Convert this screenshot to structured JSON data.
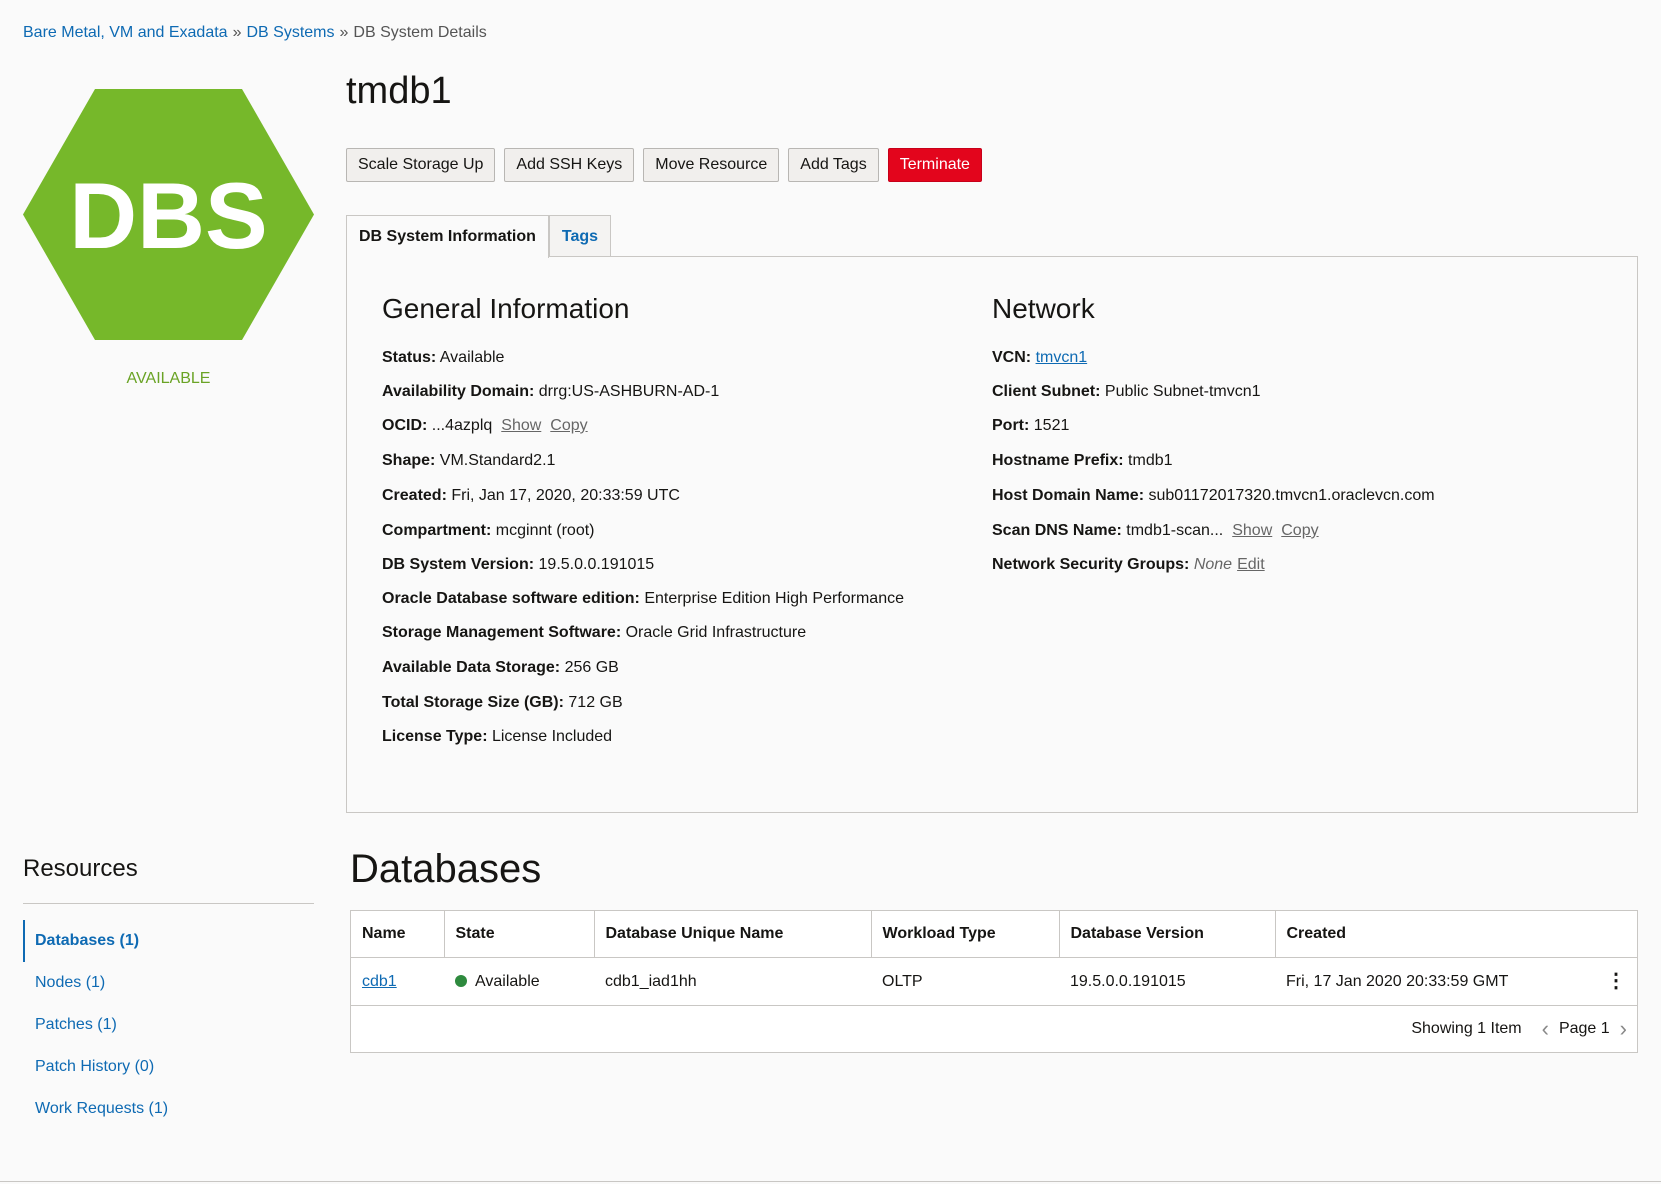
{
  "breadcrumb": {
    "items": [
      "Bare Metal, VM and Exadata",
      "DB Systems"
    ],
    "current": "DB System Details",
    "separator": "»"
  },
  "badge": {
    "text": "DBS",
    "color": "#76b82a",
    "status": "AVAILABLE"
  },
  "title": "tmdb1",
  "actions": [
    "Scale Storage Up",
    "Add SSH Keys",
    "Move Resource",
    "Add Tags",
    "Terminate"
  ],
  "tabs": [
    "DB System Information",
    "Tags"
  ],
  "general": {
    "heading": "General Information",
    "status": {
      "label": "Status:",
      "value": "Available"
    },
    "ad": {
      "label": "Availability Domain:",
      "value": "drrg:US-ASHBURN-AD-1"
    },
    "ocid": {
      "label": "OCID:",
      "value": "...4azplq",
      "show": "Show",
      "copy": "Copy"
    },
    "shape": {
      "label": "Shape:",
      "value": "VM.Standard2.1"
    },
    "created": {
      "label": "Created:",
      "value": "Fri, Jan 17, 2020, 20:33:59 UTC"
    },
    "compartment": {
      "label": "Compartment:",
      "value": "mcginnt (root)"
    },
    "version": {
      "label": "DB System Version:",
      "value": "19.5.0.0.191015"
    },
    "edition": {
      "label": "Oracle Database software edition:",
      "value": "Enterprise Edition High Performance"
    },
    "storage_mgmt": {
      "label": "Storage Management Software:",
      "value": "Oracle Grid Infrastructure"
    },
    "data_storage": {
      "label": "Available Data Storage:",
      "value": "256 GB"
    },
    "total_storage": {
      "label": "Total Storage Size (GB):",
      "value": "712 GB"
    },
    "license": {
      "label": "License Type:",
      "value": "License Included"
    }
  },
  "network": {
    "heading": "Network",
    "vcn": {
      "label": "VCN:",
      "value": "tmvcn1"
    },
    "subnet": {
      "label": "Client Subnet:",
      "value": "Public Subnet-tmvcn1"
    },
    "port": {
      "label": "Port:",
      "value": "1521"
    },
    "hostname": {
      "label": "Hostname Prefix:",
      "value": "tmdb1"
    },
    "domain": {
      "label": "Host Domain Name:",
      "value": "sub01172017320.tmvcn1.oraclevcn.com"
    },
    "scan": {
      "label": "Scan DNS Name:",
      "value": "tmdb1-scan...",
      "show": "Show",
      "copy": "Copy"
    },
    "nsg": {
      "label": "Network Security Groups:",
      "value": "None",
      "edit": "Edit"
    }
  },
  "resources": {
    "title": "Resources",
    "items": [
      "Databases (1)",
      "Nodes (1)",
      "Patches (1)",
      "Patch History (0)",
      "Work Requests (1)"
    ]
  },
  "databases": {
    "title": "Databases",
    "columns": [
      "Name",
      "State",
      "Database Unique Name",
      "Workload Type",
      "Database Version",
      "Created"
    ],
    "rows": [
      {
        "name": "cdb1",
        "state": "Available",
        "unique_name": "cdb1_iad1hh",
        "workload": "OLTP",
        "version": "19.5.0.0.191015",
        "created": "Fri, 17 Jan 2020 20:33:59 GMT"
      }
    ],
    "showing": "Showing 1 Item",
    "page": "Page 1"
  }
}
